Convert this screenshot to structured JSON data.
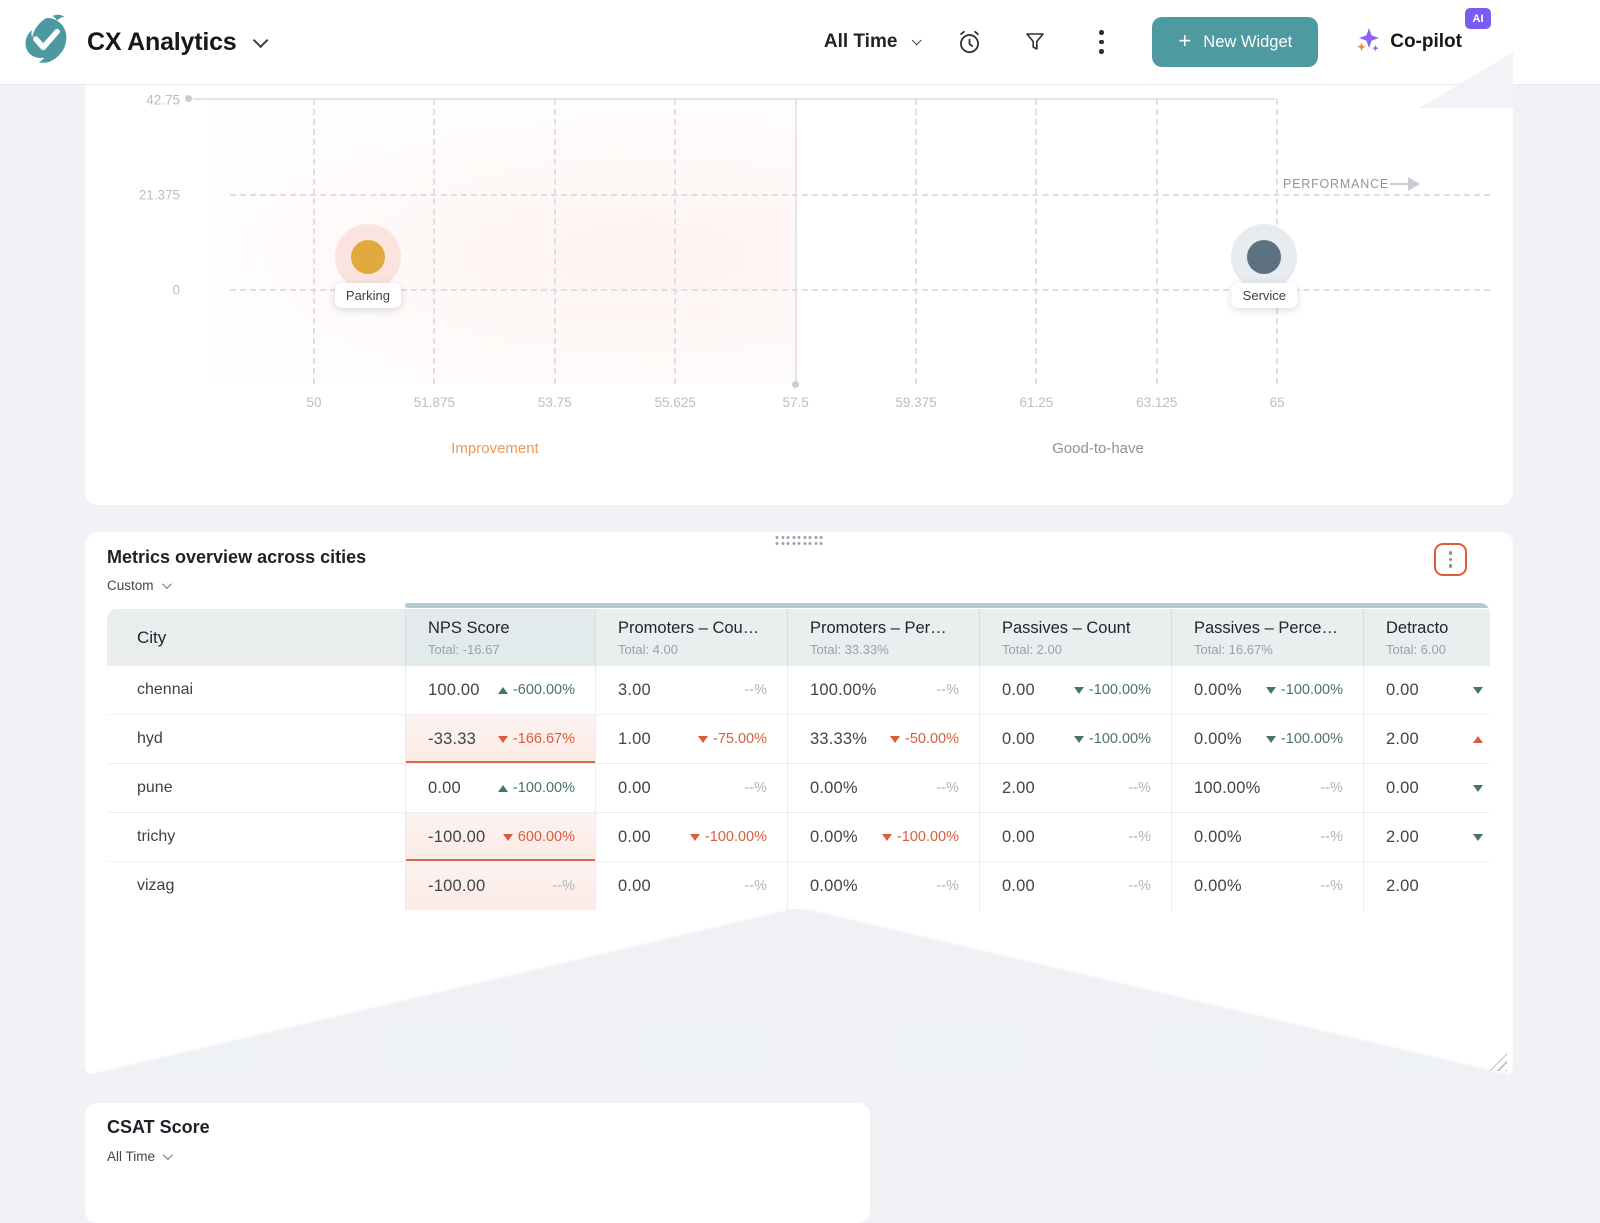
{
  "header": {
    "app_title": "CX Analytics",
    "time_range": "All Time",
    "new_widget_label": "New Widget",
    "copilot_label": "Co-pilot",
    "ai_badge": "AI",
    "icons": [
      "app-logo",
      "chevron-down",
      "alarm-clock",
      "filter-funnel",
      "kebab-menu",
      "plus",
      "sparkle"
    ]
  },
  "colors": {
    "accent_teal": "#4E9AA1",
    "accent_purple": "#7B5CF0",
    "negative_red": "#DD5C3B",
    "positive_green": "#477761",
    "parking_point": "#E2A93F",
    "service_point": "#5C7280"
  },
  "chart_data": {
    "type": "scatter",
    "title": "",
    "axis_arrow_label": "PERFORMANCE",
    "x_ticks": [
      "50",
      "51.875",
      "53.75",
      "55.625",
      "57.5",
      "59.375",
      "61.25",
      "63.125",
      "65"
    ],
    "y_ticks": [
      "42.75",
      "21.375",
      "0"
    ],
    "xlim": [
      50,
      65
    ],
    "ylim": [
      0,
      42.75
    ],
    "x_divider": 57.5,
    "grid": "dashed",
    "quadrant_labels": {
      "left": "Improvement",
      "right": "Good-to-have"
    },
    "points": [
      {
        "label": "Parking",
        "x": 50.84,
        "y": 7.4,
        "color": "#E2A93F",
        "halo": "rgba(236,110,85,0.16)"
      },
      {
        "label": "Service",
        "x": 64.8,
        "y": 7.5,
        "color": "#5C7280",
        "halo": "#E8EBEF"
      }
    ]
  },
  "table": {
    "title": "Metrics overview across cities",
    "filter_label": "Custom",
    "total_label": "Total:",
    "columns": [
      {
        "key": "city",
        "label": "City",
        "total": ""
      },
      {
        "key": "nps",
        "label": "NPS Score",
        "total": "-16.67"
      },
      {
        "key": "prom_count",
        "label": "Promoters – Cou…",
        "total": "4.00"
      },
      {
        "key": "prom_pct",
        "label": "Promoters – Per…",
        "total": "33.33%"
      },
      {
        "key": "pass_count",
        "label": "Passives – Count",
        "total": "2.00"
      },
      {
        "key": "pass_pct",
        "label": "Passives – Perce…",
        "total": "16.67%"
      },
      {
        "key": "detr",
        "label": "Detracto",
        "total": "6.00"
      }
    ],
    "rows": [
      {
        "city": "chennai",
        "nps": {
          "v": "100.00",
          "chg": "-600.00%",
          "dir": "up",
          "tone": "pos"
        },
        "prom_count": {
          "v": "3.00",
          "chg": "--%",
          "tone": "muted"
        },
        "prom_pct": {
          "v": "100.00%",
          "chg": "--%",
          "tone": "muted"
        },
        "pass_count": {
          "v": "0.00",
          "chg": "-100.00%",
          "dir": "down",
          "tone": "pos"
        },
        "pass_pct": {
          "v": "0.00%",
          "chg": "-100.00%",
          "dir": "down",
          "tone": "pos"
        },
        "detr": {
          "v": "0.00",
          "chg": "",
          "dir": "down",
          "tone": "pos"
        }
      },
      {
        "city": "hyd",
        "nps": {
          "v": "-33.33",
          "chg": "-166.67%",
          "dir": "down",
          "tone": "neg",
          "pink": true,
          "line": true
        },
        "prom_count": {
          "v": "1.00",
          "chg": "-75.00%",
          "dir": "down",
          "tone": "neg"
        },
        "prom_pct": {
          "v": "33.33%",
          "chg": "-50.00%",
          "dir": "down",
          "tone": "neg"
        },
        "pass_count": {
          "v": "0.00",
          "chg": "-100.00%",
          "dir": "down",
          "tone": "pos"
        },
        "pass_pct": {
          "v": "0.00%",
          "chg": "-100.00%",
          "dir": "down",
          "tone": "pos"
        },
        "detr": {
          "v": "2.00",
          "chg": "",
          "dir": "up",
          "tone": "neg"
        }
      },
      {
        "city": "pune",
        "nps": {
          "v": "0.00",
          "chg": "-100.00%",
          "dir": "up",
          "tone": "pos"
        },
        "prom_count": {
          "v": "0.00",
          "chg": "--%",
          "tone": "muted"
        },
        "prom_pct": {
          "v": "0.00%",
          "chg": "--%",
          "tone": "muted"
        },
        "pass_count": {
          "v": "2.00",
          "chg": "--%",
          "tone": "muted"
        },
        "pass_pct": {
          "v": "100.00%",
          "chg": "--%",
          "tone": "muted"
        },
        "detr": {
          "v": "0.00",
          "chg": "",
          "dir": "down",
          "tone": "pos"
        }
      },
      {
        "city": "trichy",
        "nps": {
          "v": "-100.00",
          "chg": "600.00%",
          "dir": "down",
          "tone": "neg",
          "pink": true,
          "line": true
        },
        "prom_count": {
          "v": "0.00",
          "chg": "-100.00%",
          "dir": "down",
          "tone": "neg"
        },
        "prom_pct": {
          "v": "0.00%",
          "chg": "-100.00%",
          "dir": "down",
          "tone": "neg"
        },
        "pass_count": {
          "v": "0.00",
          "chg": "--%",
          "tone": "muted"
        },
        "pass_pct": {
          "v": "0.00%",
          "chg": "--%",
          "tone": "muted"
        },
        "detr": {
          "v": "2.00",
          "chg": "",
          "dir": "down",
          "tone": "pos"
        }
      },
      {
        "city": "vizag",
        "nps": {
          "v": "-100.00",
          "chg": "--%",
          "tone": "muted",
          "pink": true
        },
        "prom_count": {
          "v": "0.00",
          "chg": "--%",
          "tone": "muted"
        },
        "prom_pct": {
          "v": "0.00%",
          "chg": "--%",
          "tone": "muted"
        },
        "pass_count": {
          "v": "0.00",
          "chg": "--%",
          "tone": "muted"
        },
        "pass_pct": {
          "v": "0.00%",
          "chg": "--%",
          "tone": "muted"
        },
        "detr": {
          "v": "2.00",
          "chg": "",
          "tone": "muted"
        }
      }
    ]
  },
  "csat": {
    "title": "CSAT Score",
    "filter_label": "All Time"
  }
}
